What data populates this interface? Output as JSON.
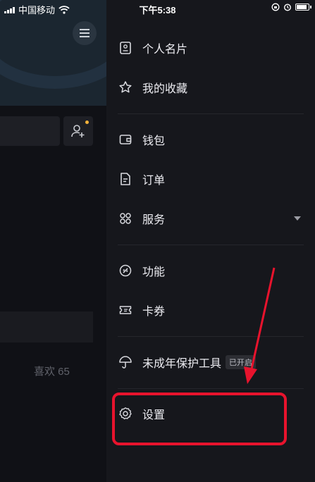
{
  "status_bar": {
    "carrier": "中国移动",
    "time": "下午5:38"
  },
  "background_page": {
    "likes_label": "喜欢 65"
  },
  "drawer": {
    "items": [
      {
        "label": "个人名片",
        "icon": "id-card-icon"
      },
      {
        "label": "我的收藏",
        "icon": "star-icon"
      },
      {
        "label": "钱包",
        "icon": "wallet-icon"
      },
      {
        "label": "订单",
        "icon": "document-icon"
      },
      {
        "label": "服务",
        "icon": "grid-services-icon"
      },
      {
        "label": "功能",
        "icon": "link-icon"
      },
      {
        "label": "卡券",
        "icon": "ticket-icon"
      },
      {
        "label": "未成年保护工具",
        "icon": "umbrella-icon",
        "badge": "已开启"
      },
      {
        "label": "设置",
        "icon": "gear-icon"
      }
    ]
  },
  "annotation": {
    "highlight_color": "#e8132d"
  }
}
